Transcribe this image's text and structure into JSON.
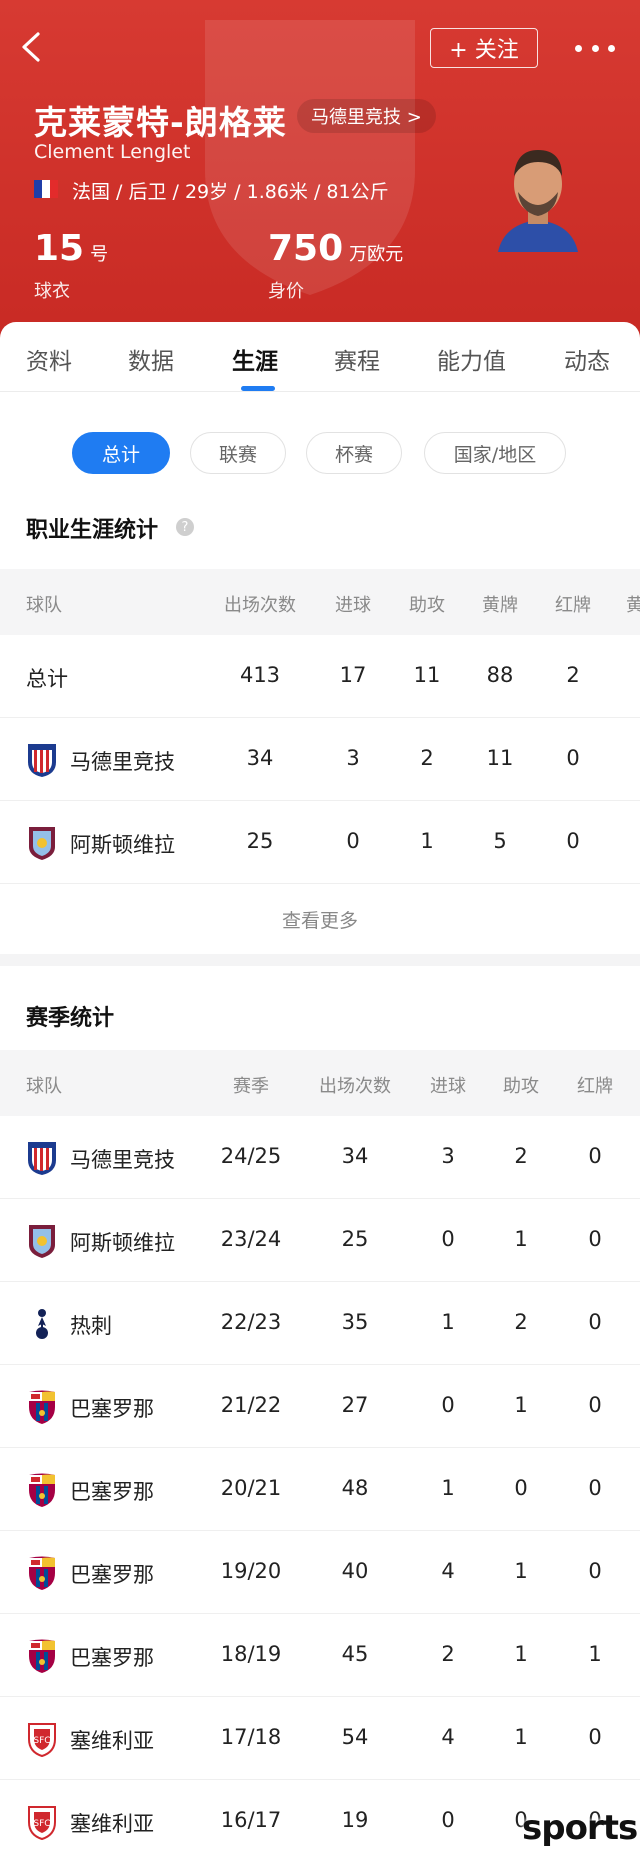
{
  "header": {
    "follow_label": "+ 关注",
    "player_name_cn": "克莱蒙特-朗格莱",
    "club_link": "马德里竞技 >",
    "player_name_en": "Clement Lenglet",
    "meta": "法国 / 后卫 / 29岁 / 1.86米 / 81公斤",
    "shirt_number": "15",
    "shirt_unit": "号",
    "shirt_label": "球衣",
    "value": "750",
    "value_unit": "万欧元",
    "value_label": "身价",
    "brand_color": "#cf302a"
  },
  "tabs": [
    "资料",
    "数据",
    "生涯",
    "赛程",
    "能力值",
    "动态"
  ],
  "active_tab": "生涯",
  "filters": [
    "总计",
    "联赛",
    "杯赛",
    "国家/地区"
  ],
  "career": {
    "title": "职业生涯统计",
    "help_icon": "?",
    "columns": [
      "球队",
      "出场次数",
      "进球",
      "助攻",
      "黄牌",
      "红牌",
      "黄"
    ],
    "rows": [
      {
        "team": "总计",
        "apps": "413",
        "goals": "17",
        "assists": "11",
        "yellow": "88",
        "red": "2"
      },
      {
        "team": "马德里竞技",
        "logo": "atletico-logo-icon",
        "apps": "34",
        "goals": "3",
        "assists": "2",
        "yellow": "11",
        "red": "0"
      },
      {
        "team": "阿斯顿维拉",
        "logo": "aston-villa-logo-icon",
        "apps": "25",
        "goals": "0",
        "assists": "1",
        "yellow": "5",
        "red": "0"
      }
    ],
    "see_more": "查看更多"
  },
  "season": {
    "title": "赛季统计",
    "columns": [
      "球队",
      "赛季",
      "出场次数",
      "进球",
      "助攻",
      "红牌"
    ],
    "rows": [
      {
        "team": "马德里竞技",
        "logo": "atletico-logo-icon",
        "season": "24/25",
        "apps": "34",
        "goals": "3",
        "assists": "2",
        "red": "0"
      },
      {
        "team": "阿斯顿维拉",
        "logo": "aston-villa-logo-icon",
        "season": "23/24",
        "apps": "25",
        "goals": "0",
        "assists": "1",
        "red": "0"
      },
      {
        "team": "热刺",
        "logo": "tottenham-logo-icon",
        "season": "22/23",
        "apps": "35",
        "goals": "1",
        "assists": "2",
        "red": "0"
      },
      {
        "team": "巴塞罗那",
        "logo": "barcelona-logo-icon",
        "season": "21/22",
        "apps": "27",
        "goals": "0",
        "assists": "1",
        "red": "0"
      },
      {
        "team": "巴塞罗那",
        "logo": "barcelona-logo-icon",
        "season": "20/21",
        "apps": "48",
        "goals": "1",
        "assists": "0",
        "red": "0"
      },
      {
        "team": "巴塞罗那",
        "logo": "barcelona-logo-icon",
        "season": "19/20",
        "apps": "40",
        "goals": "4",
        "assists": "1",
        "red": "0"
      },
      {
        "team": "巴塞罗那",
        "logo": "barcelona-logo-icon",
        "season": "18/19",
        "apps": "45",
        "goals": "2",
        "assists": "1",
        "red": "1"
      },
      {
        "team": "塞维利亚",
        "logo": "sevilla-logo-icon",
        "season": "17/18",
        "apps": "54",
        "goals": "4",
        "assists": "1",
        "red": "0"
      },
      {
        "team": "塞维利亚",
        "logo": "sevilla-logo-icon",
        "season": "16/17",
        "apps": "19",
        "goals": "0",
        "assists": "0",
        "red": "0"
      }
    ]
  },
  "watermark": "sports"
}
